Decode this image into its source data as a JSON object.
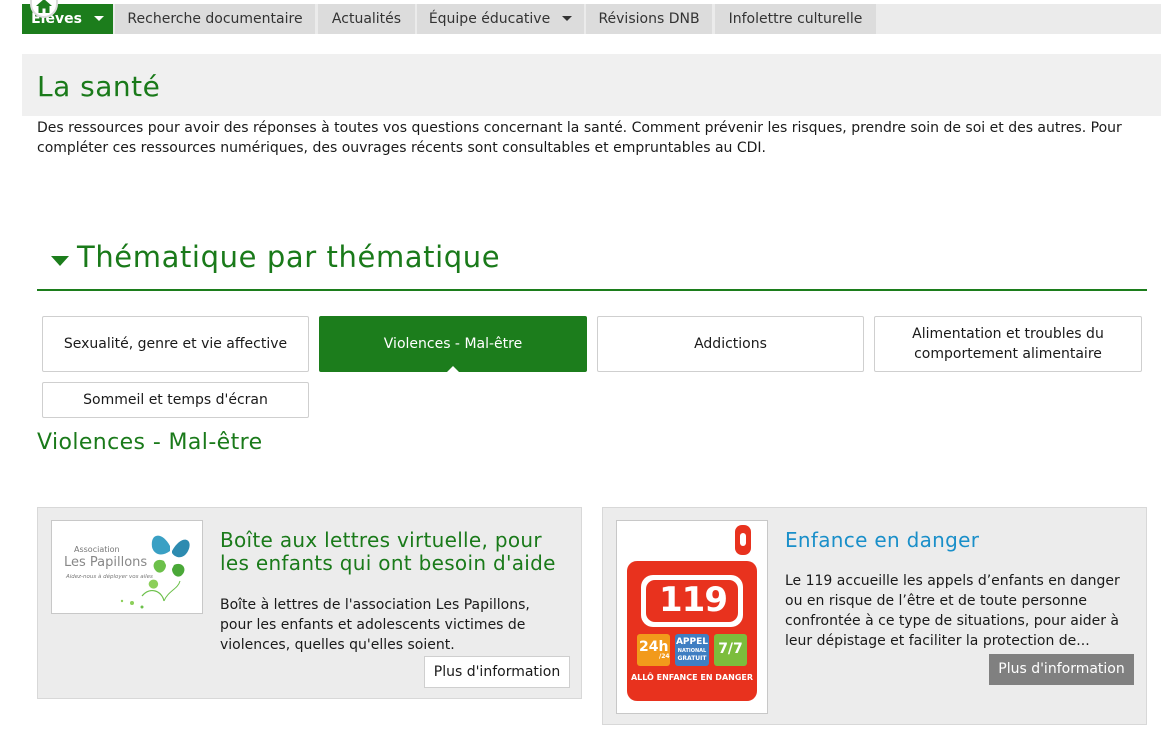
{
  "nav": {
    "items": [
      {
        "label": "Élèves",
        "has_dropdown": true,
        "active": true
      },
      {
        "label": "Recherche documentaire",
        "has_dropdown": false
      },
      {
        "label": "Actualités",
        "has_dropdown": false
      },
      {
        "label": "Équipe éducative",
        "has_dropdown": true
      },
      {
        "label": "Révisions DNB",
        "has_dropdown": false
      },
      {
        "label": "Infolettre culturelle",
        "has_dropdown": false
      }
    ]
  },
  "page": {
    "title": "La santé",
    "intro": "Des ressources pour avoir des réponses à toutes vos questions concernant la santé. Comment prévenir les risques, prendre soin de soi et des autres. Pour compléter ces ressources numériques, des ouvrages récents sont consultables et empruntables au CDI."
  },
  "section": {
    "title": "Thématique par thématique"
  },
  "tabs": [
    {
      "label": "Sexualité, genre et vie affective"
    },
    {
      "label": "Violences - Mal-être",
      "active": true
    },
    {
      "label": "Addictions"
    },
    {
      "label": "Alimentation et troubles du comportement alimentaire"
    },
    {
      "label": "Sommeil et temps d'écran"
    }
  ],
  "active_panel": {
    "title": "Violences - Mal-être"
  },
  "cards": [
    {
      "title": "Boîte aux lettres virtuelle, pour les enfants qui ont besoin d'aide",
      "description": "Boîte à lettres de l'association Les Papillons, pour les enfants et adolescents victimes de violences, quelles qu'elles soient.",
      "button": "Plus d'information",
      "logo": {
        "line1": "Association",
        "line2": "Les Papillons",
        "tagline": "Aidez-nous à déployer vos ailes"
      }
    },
    {
      "title": "Enfance en danger",
      "description": "Le 119 accueille les appels d’enfants en danger ou en risque de l’être et de toute personne confrontée à ce type de situations, pour aider à leur dépistage et faciliter la protection de...",
      "button": "Plus d'information",
      "logo": {
        "number": "119",
        "badge1": "24h",
        "badge1_sub": "/24",
        "badge2_l1": "APPEL",
        "badge2_l2": "NATIONAL",
        "badge2_l3": "GRATUIT",
        "badge3": "7/7",
        "footer": "ALLÔ ENFANCE EN DANGER"
      }
    }
  ],
  "colors": {
    "brand_green": "#1c7d1c",
    "title_green": "#1a7a1a",
    "link_blue": "#1a8fc9",
    "red_119": "#e8321e"
  }
}
